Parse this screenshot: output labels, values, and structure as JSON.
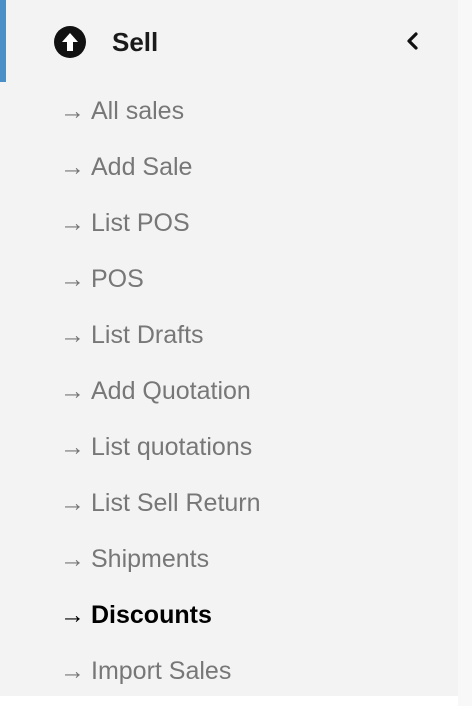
{
  "menu": {
    "title": "Sell",
    "icon": "arrow-circle-up-icon",
    "toggle_icon": "chevron-left-icon",
    "accent_color": "#4a8fc7",
    "arrow_glyph": "→",
    "items": [
      {
        "label": "All sales",
        "active": false
      },
      {
        "label": "Add Sale",
        "active": false
      },
      {
        "label": "List POS",
        "active": false
      },
      {
        "label": "POS",
        "active": false
      },
      {
        "label": "List Drafts",
        "active": false
      },
      {
        "label": "Add Quotation",
        "active": false
      },
      {
        "label": "List quotations",
        "active": false
      },
      {
        "label": "List Sell Return",
        "active": false
      },
      {
        "label": "Shipments",
        "active": false
      },
      {
        "label": "Discounts",
        "active": true
      },
      {
        "label": "Import Sales",
        "active": false
      }
    ]
  }
}
